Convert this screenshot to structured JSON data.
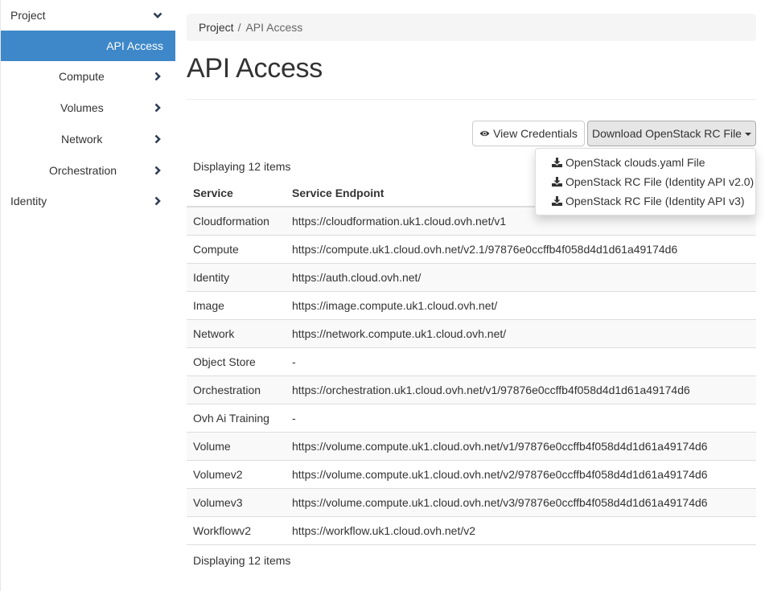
{
  "sidebar": {
    "project_label": "Project",
    "active_item": "API Access",
    "items": [
      {
        "label": "Compute"
      },
      {
        "label": "Volumes"
      },
      {
        "label": "Network"
      },
      {
        "label": "Orchestration"
      }
    ],
    "identity_label": "Identity"
  },
  "breadcrumb": {
    "parent": "Project",
    "separator": "/",
    "current": "API Access"
  },
  "page": {
    "title": "API Access"
  },
  "actions": {
    "view_credentials": "View Credentials",
    "download_rc": "Download OpenStack RC File"
  },
  "dropdown": {
    "items": [
      {
        "label": "OpenStack clouds.yaml File",
        "icon": "download-icon"
      },
      {
        "label": "OpenStack RC File (Identity API v2.0)",
        "icon": "download-icon"
      },
      {
        "label": "OpenStack RC File (Identity API v3)",
        "icon": "download-icon"
      }
    ]
  },
  "table": {
    "count_text": "Displaying 12 items",
    "headers": {
      "service": "Service",
      "endpoint": "Service Endpoint"
    },
    "rows": [
      {
        "service": "Cloudformation",
        "endpoint": "https://cloudformation.uk1.cloud.ovh.net/v1"
      },
      {
        "service": "Compute",
        "endpoint": "https://compute.uk1.cloud.ovh.net/v2.1/97876e0ccffb4f058d4d1d61a49174d6"
      },
      {
        "service": "Identity",
        "endpoint": "https://auth.cloud.ovh.net/"
      },
      {
        "service": "Image",
        "endpoint": "https://image.compute.uk1.cloud.ovh.net/"
      },
      {
        "service": "Network",
        "endpoint": "https://network.compute.uk1.cloud.ovh.net/"
      },
      {
        "service": "Object Store",
        "endpoint": "-"
      },
      {
        "service": "Orchestration",
        "endpoint": "https://orchestration.uk1.cloud.ovh.net/v1/97876e0ccffb4f058d4d1d61a49174d6"
      },
      {
        "service": "Ovh Ai Training",
        "endpoint": "-"
      },
      {
        "service": "Volume",
        "endpoint": "https://volume.compute.uk1.cloud.ovh.net/v1/97876e0ccffb4f058d4d1d61a49174d6"
      },
      {
        "service": "Volumev2",
        "endpoint": "https://volume.compute.uk1.cloud.ovh.net/v2/97876e0ccffb4f058d4d1d61a49174d6"
      },
      {
        "service": "Volumev3",
        "endpoint": "https://volume.compute.uk1.cloud.ovh.net/v3/97876e0ccffb4f058d4d1d61a49174d6"
      },
      {
        "service": "Workflowv2",
        "endpoint": "https://workflow.uk1.cloud.ovh.net/v2"
      }
    ]
  },
  "colors": {
    "active_nav": "#3e88c9",
    "chevron": "#2e3d55"
  }
}
